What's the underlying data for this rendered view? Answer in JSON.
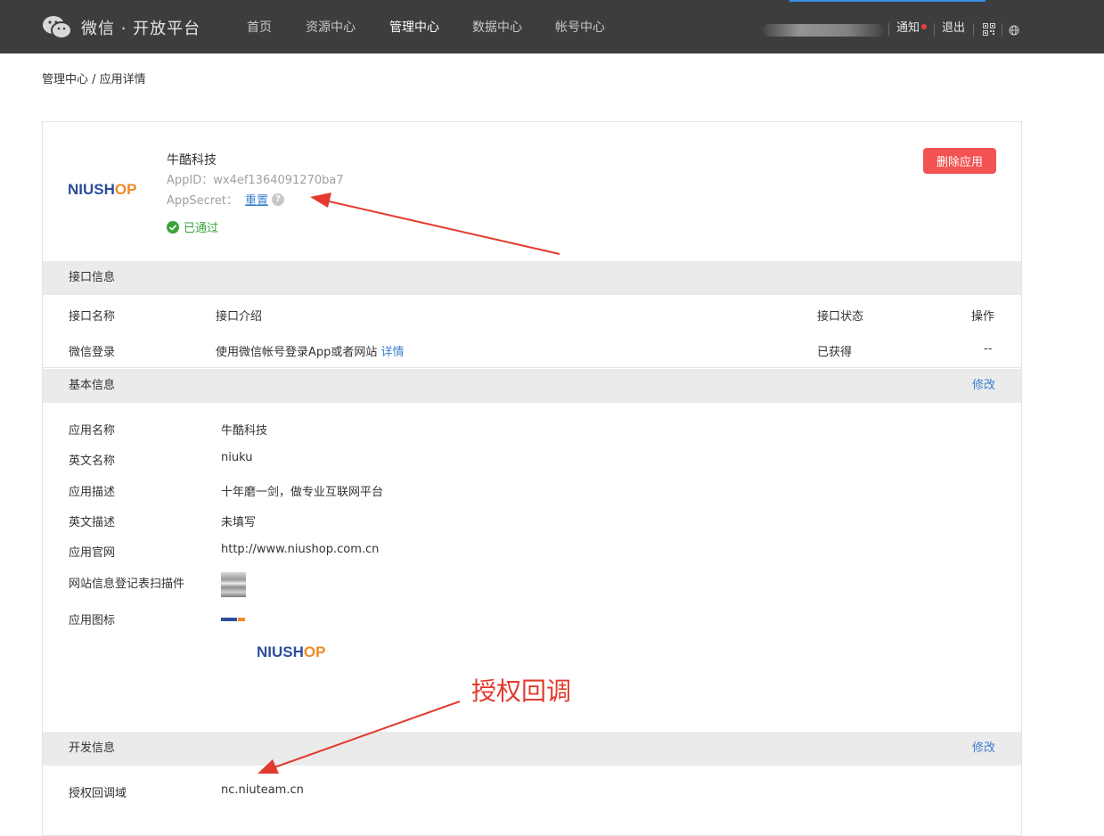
{
  "brand": {
    "title": "微信 · 开放平台"
  },
  "nav": [
    {
      "label": "首页"
    },
    {
      "label": "资源中心"
    },
    {
      "label": "管理中心"
    },
    {
      "label": "数据中心"
    },
    {
      "label": "帐号中心"
    }
  ],
  "topright": {
    "notice": "通知",
    "logout": "退出"
  },
  "breadcrumb": "管理中心 / 应用详情",
  "app": {
    "logo_text": "NIUSHOP",
    "name": "牛酷科技",
    "appid": "AppID：wx4ef1364091270ba7",
    "secret_label": "AppSecret：",
    "secret_reset": "重置",
    "help": "?",
    "status": "已通过",
    "delete_label": "删除应用"
  },
  "api": {
    "title": "接口信息",
    "headers": [
      "接口名称",
      "接口介绍",
      "接口状态",
      "操作"
    ],
    "row": {
      "name": "微信登录",
      "desc": "使用微信帐号登录App或者网站",
      "detail": "详情",
      "status": "已获得",
      "op": "--"
    }
  },
  "basic": {
    "title": "基本信息",
    "edit": "修改",
    "rows": [
      {
        "label": "应用名称",
        "value": "牛酷科技"
      },
      {
        "label": "英文名称",
        "value": "niuku"
      },
      {
        "label": "应用描述",
        "value": "十年磨一剑，做专业互联网平台"
      },
      {
        "label": "英文描述",
        "value": "未填写"
      },
      {
        "label": "应用官网",
        "value": "http://www.niushop.com.cn"
      },
      {
        "label": "网站信息登记表扫描件"
      },
      {
        "label": "应用图标"
      }
    ]
  },
  "annotation": "授权回调",
  "dev": {
    "title": "开发信息",
    "edit": "修改",
    "callback_label": "授权回调域",
    "callback_value": "nc.niuteam.cn"
  },
  "colors": {
    "topbar": "#3c3d3f",
    "link": "#3a7ed1",
    "danger": "#f35353",
    "success": "#37a33a",
    "annotation": "#e23b2e",
    "logo_blue": "#2d4e9c",
    "logo_orange": "#f08a24"
  }
}
